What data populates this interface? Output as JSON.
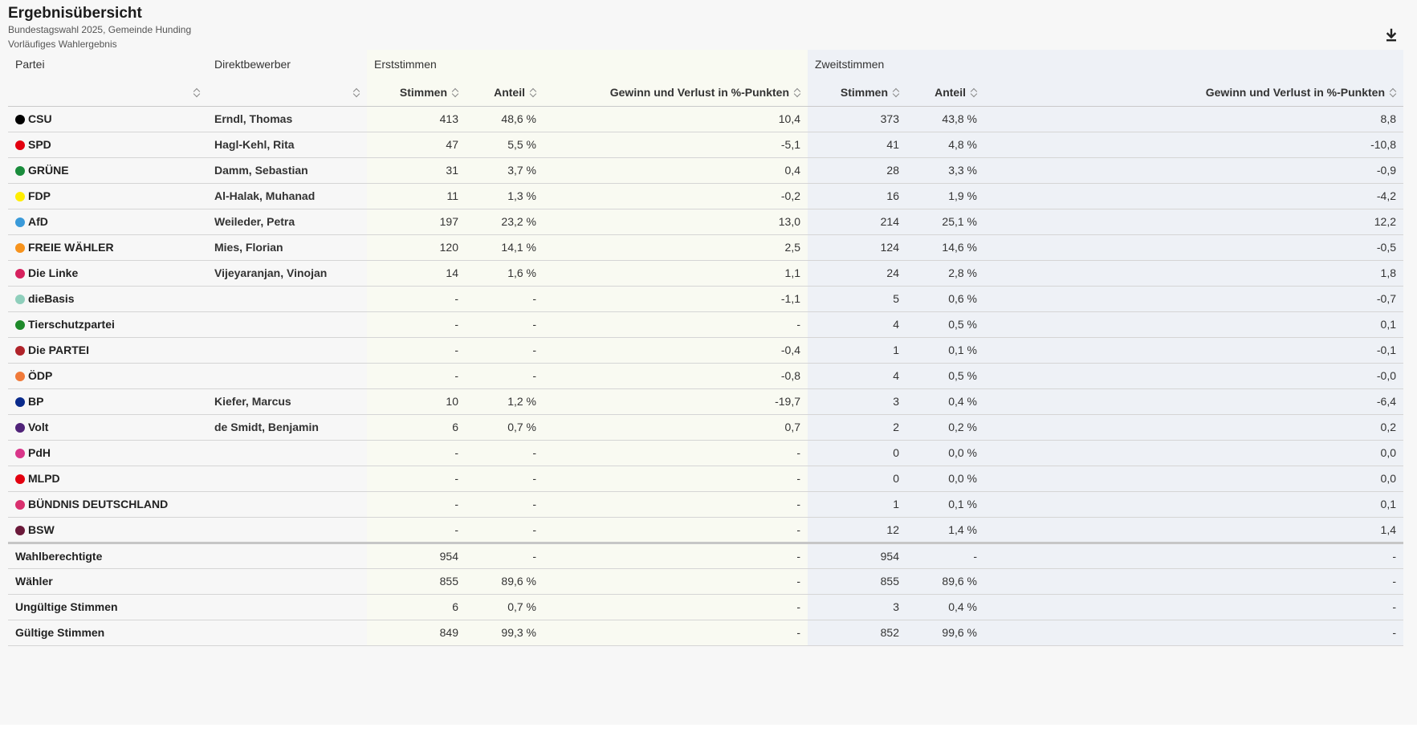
{
  "header": {
    "title": "Ergebnisübersicht",
    "subtitle1": "Bundestagswahl 2025, Gemeinde Hunding",
    "subtitle2": "Vorläufiges Wahlergebnis",
    "download_icon": "download-icon"
  },
  "columns": {
    "partei": "Partei",
    "direktbewerber": "Direktbewerber",
    "erststimmen": "Erststimmen",
    "zweitstimmen": "Zweitstimmen",
    "stimmen": "Stimmen",
    "anteil": "Anteil",
    "gewinn": "Gewinn und Verlust in %-Punkten"
  },
  "colors": {
    "erst_bg": "#f9faf2",
    "zweit_bg": "#eef1f6"
  },
  "parties": [
    {
      "name": "CSU",
      "color": "#000000",
      "candidate": "Erndl, Thomas",
      "e_stimmen": "413",
      "e_anteil": "48,6 %",
      "e_diff": "10,4",
      "z_stimmen": "373",
      "z_anteil": "43,8 %",
      "z_diff": "8,8"
    },
    {
      "name": "SPD",
      "color": "#e3000f",
      "candidate": "Hagl-Kehl, Rita",
      "e_stimmen": "47",
      "e_anteil": "5,5 %",
      "e_diff": "-5,1",
      "z_stimmen": "41",
      "z_anteil": "4,8 %",
      "z_diff": "-10,8"
    },
    {
      "name": "GRÜNE",
      "color": "#1a8c3c",
      "candidate": "Damm, Sebastian",
      "e_stimmen": "31",
      "e_anteil": "3,7 %",
      "e_diff": "0,4",
      "z_stimmen": "28",
      "z_anteil": "3,3 %",
      "z_diff": "-0,9"
    },
    {
      "name": "FDP",
      "color": "#ffed00",
      "candidate": "Al-Halak, Muhanad",
      "e_stimmen": "11",
      "e_anteil": "1,3 %",
      "e_diff": "-0,2",
      "z_stimmen": "16",
      "z_anteil": "1,9 %",
      "z_diff": "-4,2"
    },
    {
      "name": "AfD",
      "color": "#3a9ad9",
      "candidate": "Weileder, Petra",
      "e_stimmen": "197",
      "e_anteil": "23,2 %",
      "e_diff": "13,0",
      "z_stimmen": "214",
      "z_anteil": "25,1 %",
      "z_diff": "12,2"
    },
    {
      "name": "FREIE WÄHLER",
      "color": "#f7931d",
      "candidate": "Mies, Florian",
      "e_stimmen": "120",
      "e_anteil": "14,1 %",
      "e_diff": "2,5",
      "z_stimmen": "124",
      "z_anteil": "14,6 %",
      "z_diff": "-0,5"
    },
    {
      "name": "Die Linke",
      "color": "#d6225e",
      "candidate": "Vijeyaranjan, Vinojan",
      "e_stimmen": "14",
      "e_anteil": "1,6 %",
      "e_diff": "1,1",
      "z_stimmen": "24",
      "z_anteil": "2,8 %",
      "z_diff": "1,8"
    },
    {
      "name": "dieBasis",
      "color": "#8fcfbc",
      "candidate": "",
      "e_stimmen": "-",
      "e_anteil": "-",
      "e_diff": "-1,1",
      "z_stimmen": "5",
      "z_anteil": "0,6 %",
      "z_diff": "-0,7"
    },
    {
      "name": "Tierschutzpartei",
      "color": "#1e8a2a",
      "candidate": "",
      "e_stimmen": "-",
      "e_anteil": "-",
      "e_diff": "-",
      "z_stimmen": "4",
      "z_anteil": "0,5 %",
      "z_diff": "0,1"
    },
    {
      "name": "Die PARTEI",
      "color": "#b0232a",
      "candidate": "",
      "e_stimmen": "-",
      "e_anteil": "-",
      "e_diff": "-0,4",
      "z_stimmen": "1",
      "z_anteil": "0,1 %",
      "z_diff": "-0,1"
    },
    {
      "name": "ÖDP",
      "color": "#f07a3a",
      "candidate": "",
      "e_stimmen": "-",
      "e_anteil": "-",
      "e_diff": "-0,8",
      "z_stimmen": "4",
      "z_anteil": "0,5 %",
      "z_diff": "-0,0"
    },
    {
      "name": "BP",
      "color": "#0a2b8c",
      "candidate": "Kiefer, Marcus",
      "e_stimmen": "10",
      "e_anteil": "1,2 %",
      "e_diff": "-19,7",
      "z_stimmen": "3",
      "z_anteil": "0,4 %",
      "z_diff": "-6,4"
    },
    {
      "name": "Volt",
      "color": "#502379",
      "candidate": "de Smidt, Benjamin",
      "e_stimmen": "6",
      "e_anteil": "0,7 %",
      "e_diff": "0,7",
      "z_stimmen": "2",
      "z_anteil": "0,2 %",
      "z_diff": "0,2"
    },
    {
      "name": "PdH",
      "color": "#d9368a",
      "candidate": "",
      "e_stimmen": "-",
      "e_anteil": "-",
      "e_diff": "-",
      "z_stimmen": "0",
      "z_anteil": "0,0 %",
      "z_diff": "0,0"
    },
    {
      "name": "MLPD",
      "color": "#e3000f",
      "candidate": "",
      "e_stimmen": "-",
      "e_anteil": "-",
      "e_diff": "-",
      "z_stimmen": "0",
      "z_anteil": "0,0 %",
      "z_diff": "0,0"
    },
    {
      "name": "BÜNDNIS DEUTSCHLAND",
      "color": "#d9306e",
      "candidate": "",
      "e_stimmen": "-",
      "e_anteil": "-",
      "e_diff": "-",
      "z_stimmen": "1",
      "z_anteil": "0,1 %",
      "z_diff": "0,1"
    },
    {
      "name": "BSW",
      "color": "#6b1a3a",
      "candidate": "",
      "e_stimmen": "-",
      "e_anteil": "-",
      "e_diff": "-",
      "z_stimmen": "12",
      "z_anteil": "1,4 %",
      "z_diff": "1,4"
    }
  ],
  "totals": [
    {
      "label": "Wahlberechtigte",
      "e_stimmen": "954",
      "e_anteil": "-",
      "e_diff": "-",
      "z_stimmen": "954",
      "z_anteil": "-",
      "z_diff": "-"
    },
    {
      "label": "Wähler",
      "e_stimmen": "855",
      "e_anteil": "89,6 %",
      "e_diff": "-",
      "z_stimmen": "855",
      "z_anteil": "89,6 %",
      "z_diff": "-"
    },
    {
      "label": "Ungültige Stimmen",
      "e_stimmen": "6",
      "e_anteil": "0,7 %",
      "e_diff": "-",
      "z_stimmen": "3",
      "z_anteil": "0,4 %",
      "z_diff": "-"
    },
    {
      "label": "Gültige Stimmen",
      "e_stimmen": "849",
      "e_anteil": "99,3 %",
      "e_diff": "-",
      "z_stimmen": "852",
      "z_anteil": "99,6 %",
      "z_diff": "-"
    }
  ]
}
